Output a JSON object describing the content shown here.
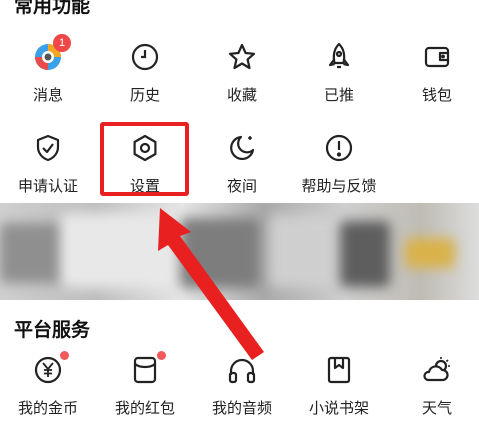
{
  "common_functions": {
    "title": "常用功能",
    "row1": [
      {
        "label": "消息",
        "icon": "chat-avatar-icon",
        "badge": "1"
      },
      {
        "label": "历史",
        "icon": "clock-icon"
      },
      {
        "label": "收藏",
        "icon": "star-icon"
      },
      {
        "label": "已推",
        "icon": "rocket-icon"
      },
      {
        "label": "钱包",
        "icon": "wallet-icon"
      }
    ],
    "row2": [
      {
        "label": "申请认证",
        "icon": "shield-check-icon"
      },
      {
        "label": "设置",
        "icon": "hexagon-gear-icon"
      },
      {
        "label": "夜间",
        "icon": "moon-icon"
      },
      {
        "label": "帮助与反馈",
        "icon": "exclamation-circle-icon"
      }
    ]
  },
  "platform_services": {
    "title": "平台服务",
    "items": [
      {
        "label": "我的金币",
        "icon": "yen-coin-icon",
        "dot": true
      },
      {
        "label": "我的红包",
        "icon": "red-packet-icon",
        "dot": true
      },
      {
        "label": "我的音频",
        "icon": "headphones-icon"
      },
      {
        "label": "小说书架",
        "icon": "bookmark-book-icon"
      },
      {
        "label": "天气",
        "icon": "weather-icon"
      }
    ]
  },
  "colors": {
    "highlight": "#e82020",
    "badge": "#f04848"
  }
}
